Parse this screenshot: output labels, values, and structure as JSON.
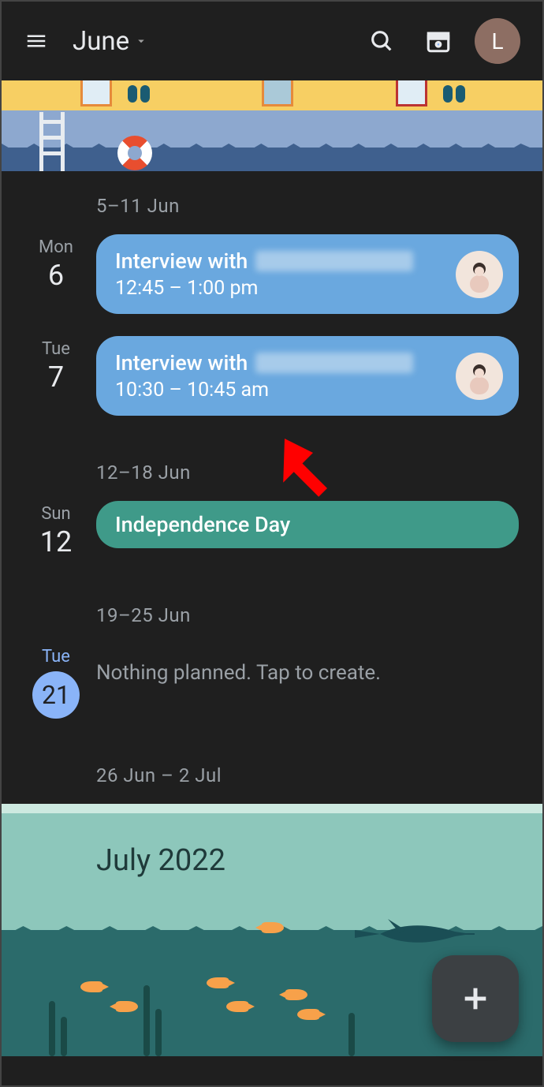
{
  "header": {
    "month_label": "June",
    "avatar_initial": "L"
  },
  "weeks": [
    {
      "range": "5–11 Jun"
    },
    {
      "range": "12–18 Jun"
    },
    {
      "range": "19–25 Jun"
    },
    {
      "range": "26 Jun – 2 Jul"
    }
  ],
  "days": {
    "mon6": {
      "dow": "Mon",
      "num": "6"
    },
    "tue7": {
      "dow": "Tue",
      "num": "7"
    },
    "sun12": {
      "dow": "Sun",
      "num": "12"
    },
    "tue21": {
      "dow": "Tue",
      "num": "21"
    }
  },
  "events": {
    "e1": {
      "title_prefix": "Interview with",
      "time": "12:45 – 1:00 pm"
    },
    "e2": {
      "title_prefix": "Interview with",
      "time": "10:30 – 10:45 am"
    },
    "e3": {
      "title": "Independence Day"
    }
  },
  "empty_day_text": "Nothing planned. Tap to create.",
  "next_month_label": "July 2022",
  "colors": {
    "event_blue": "#6aa8df",
    "event_teal": "#3f9a89",
    "accent": "#8ab4f8"
  }
}
